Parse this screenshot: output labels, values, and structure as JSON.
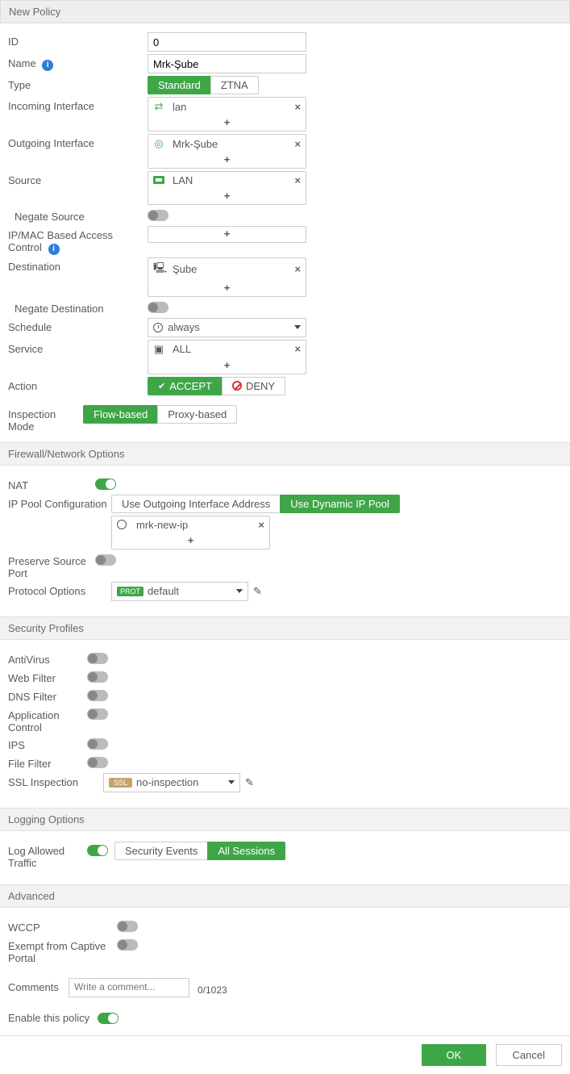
{
  "title": "New Policy",
  "fields": {
    "id_label": "ID",
    "id_value": "0",
    "name_label": "Name",
    "name_value": "Mrk-Şube",
    "type_label": "Type",
    "type_options": {
      "standard": "Standard",
      "ztna": "ZTNA"
    },
    "incoming_label": "Incoming Interface",
    "incoming_value": "lan",
    "outgoing_label": "Outgoing Interface",
    "outgoing_value": "Mrk-Şube",
    "source_label": "Source",
    "source_value": "LAN",
    "negate_source_label": "Negate Source",
    "ipmac_label": "IP/MAC Based Access Control",
    "destination_label": "Destination",
    "destination_value": "Şube",
    "negate_destination_label": "Negate Destination",
    "schedule_label": "Schedule",
    "schedule_value": "always",
    "service_label": "Service",
    "service_value": "ALL",
    "action_label": "Action",
    "action_accept": "ACCEPT",
    "action_deny": "DENY",
    "inspection_label": "Inspection Mode",
    "inspection_flow": "Flow-based",
    "inspection_proxy": "Proxy-based"
  },
  "firewall": {
    "header": "Firewall/Network Options",
    "nat_label": "NAT",
    "ippool_label": "IP Pool Configuration",
    "ippool_outgoing": "Use Outgoing Interface Address",
    "ippool_dynamic": "Use Dynamic IP Pool",
    "ippool_value": "mrk-new-ip",
    "preserve_label": "Preserve Source Port",
    "protocol_label": "Protocol Options",
    "protocol_value": "default",
    "protocol_badge": "PROT"
  },
  "security": {
    "header": "Security Profiles",
    "antivirus": "AntiVirus",
    "webfilter": "Web Filter",
    "dnsfilter": "DNS Filter",
    "appcontrol": "Application Control",
    "ips": "IPS",
    "filefilter": "File Filter",
    "ssl_label": "SSL Inspection",
    "ssl_value": "no-inspection",
    "ssl_badge": "SSL"
  },
  "logging": {
    "header": "Logging Options",
    "log_allowed": "Log Allowed Traffic",
    "sec_events": "Security Events",
    "all_sessions": "All Sessions"
  },
  "advanced": {
    "header": "Advanced",
    "wccp": "WCCP",
    "exempt": "Exempt from Captive Portal"
  },
  "comments": {
    "label": "Comments",
    "placeholder": "Write a comment...",
    "counter": "0/1023"
  },
  "enable_label": "Enable this policy",
  "footer": {
    "ok": "OK",
    "cancel": "Cancel"
  }
}
